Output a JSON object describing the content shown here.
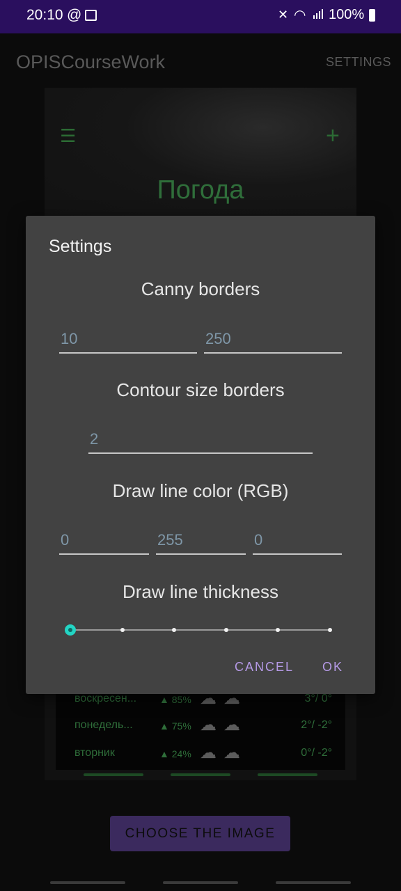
{
  "status_bar": {
    "time": "20:10",
    "at_symbol": "@",
    "battery": "100%",
    "icons": [
      "image-icon",
      "mute-icon",
      "wifi-icon",
      "signal-icon",
      "battery-icon"
    ]
  },
  "app_bar": {
    "title": "OPISCourseWork",
    "settings_label": "SETTINGS"
  },
  "background": {
    "heading": "Погода",
    "forecast": [
      {
        "day": "воскресен...",
        "humidity": "85%",
        "temp": "3°/ 0°"
      },
      {
        "day": "понедель...",
        "humidity": "75%",
        "temp": "2°/ -2°"
      },
      {
        "day": "вторник",
        "humidity": "24%",
        "temp": "0°/ -2°"
      }
    ],
    "choose_button": "CHOOSE THE IMAGE"
  },
  "dialog": {
    "title": "Settings",
    "canny_label": "Canny borders",
    "canny_min": "10",
    "canny_max": "250",
    "contour_label": "Contour size borders",
    "contour_value": "2",
    "color_label": "Draw line color (RGB)",
    "color_r": "0",
    "color_g": "255",
    "color_b": "0",
    "thickness_label": "Draw line thickness",
    "thickness_value": 0,
    "cancel": "CANCEL",
    "ok": "OK"
  },
  "colors": {
    "status_bar": "#2a0f5e",
    "dialog": "#424242",
    "accent": "#23d5c4",
    "button_text": "#b59ae6"
  }
}
